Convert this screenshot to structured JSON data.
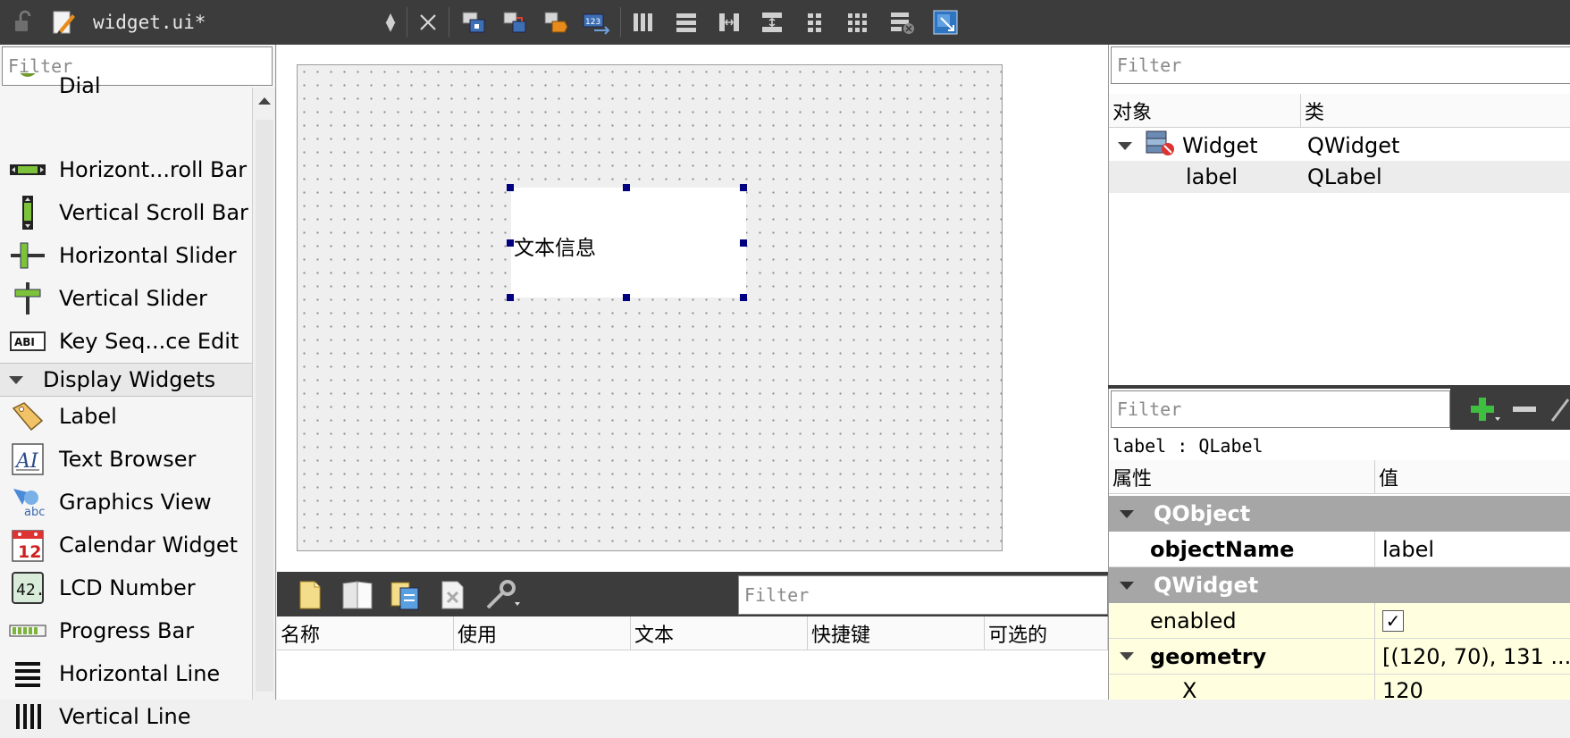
{
  "window": {
    "file_name": "widget.ui*"
  },
  "widget_box": {
    "filter_placeholder": "Filter",
    "partial_item": "Dial",
    "items_top": [
      {
        "label": "Horizont...roll Bar",
        "icon": "horizontal-scroll-bar-icon"
      },
      {
        "label": "Vertical Scroll Bar",
        "icon": "vertical-scroll-bar-icon"
      },
      {
        "label": "Horizontal Slider",
        "icon": "horizontal-slider-icon"
      },
      {
        "label": "Vertical Slider",
        "icon": "vertical-slider-icon"
      },
      {
        "label": "Key Seq...ce Edit",
        "icon": "key-sequence-edit-icon"
      }
    ],
    "category_display": "Display Widgets",
    "items_display": [
      {
        "label": "Label",
        "icon": "label-tag-icon"
      },
      {
        "label": "Text Browser",
        "icon": "text-browser-icon"
      },
      {
        "label": "Graphics View",
        "icon": "graphics-view-icon"
      },
      {
        "label": "Calendar Widget",
        "icon": "calendar-icon"
      },
      {
        "label": "LCD Number",
        "icon": "lcd-number-icon"
      },
      {
        "label": "Progress Bar",
        "icon": "progress-bar-icon"
      },
      {
        "label": "Horizontal Line",
        "icon": "horizontal-line-icon"
      },
      {
        "label": "Vertical Line",
        "icon": "vertical-line-icon"
      }
    ],
    "calendar_day": "12",
    "lcd_digits": "42.",
    "text_browser_glyph": "AI",
    "keyseq_glyph": "ABI"
  },
  "canvas": {
    "label_text": "文本信息"
  },
  "action_editor": {
    "filter_placeholder": "Filter",
    "columns": [
      "名称",
      "使用",
      "文本",
      "快捷键",
      "可选的"
    ]
  },
  "object_inspector": {
    "filter_placeholder": "Filter",
    "col_object": "对象",
    "col_class": "类",
    "rows": [
      {
        "object": "Widget",
        "class": "QWidget"
      },
      {
        "object": "label",
        "class": "QLabel"
      }
    ]
  },
  "property_editor": {
    "filter_placeholder": "Filter",
    "context": "label : QLabel",
    "col_property": "属性",
    "col_value": "值",
    "cat_qobject": "QObject",
    "object_name_key": "objectName",
    "object_name_value": "label",
    "cat_qwidget": "QWidget",
    "enabled_key": "enabled",
    "enabled_value": "✓",
    "geometry_key": "geometry",
    "geometry_value": "[(120, 70), 131 ...",
    "x_key": "X",
    "x_value": "120"
  },
  "colors": {
    "toolbar_bg": "#3c3c3c",
    "selection_handle": "#000080",
    "category_bg": "#a6a6a6",
    "qwidget_row_bg": "#ffffe0",
    "selected_row_bg": "#ececec"
  }
}
